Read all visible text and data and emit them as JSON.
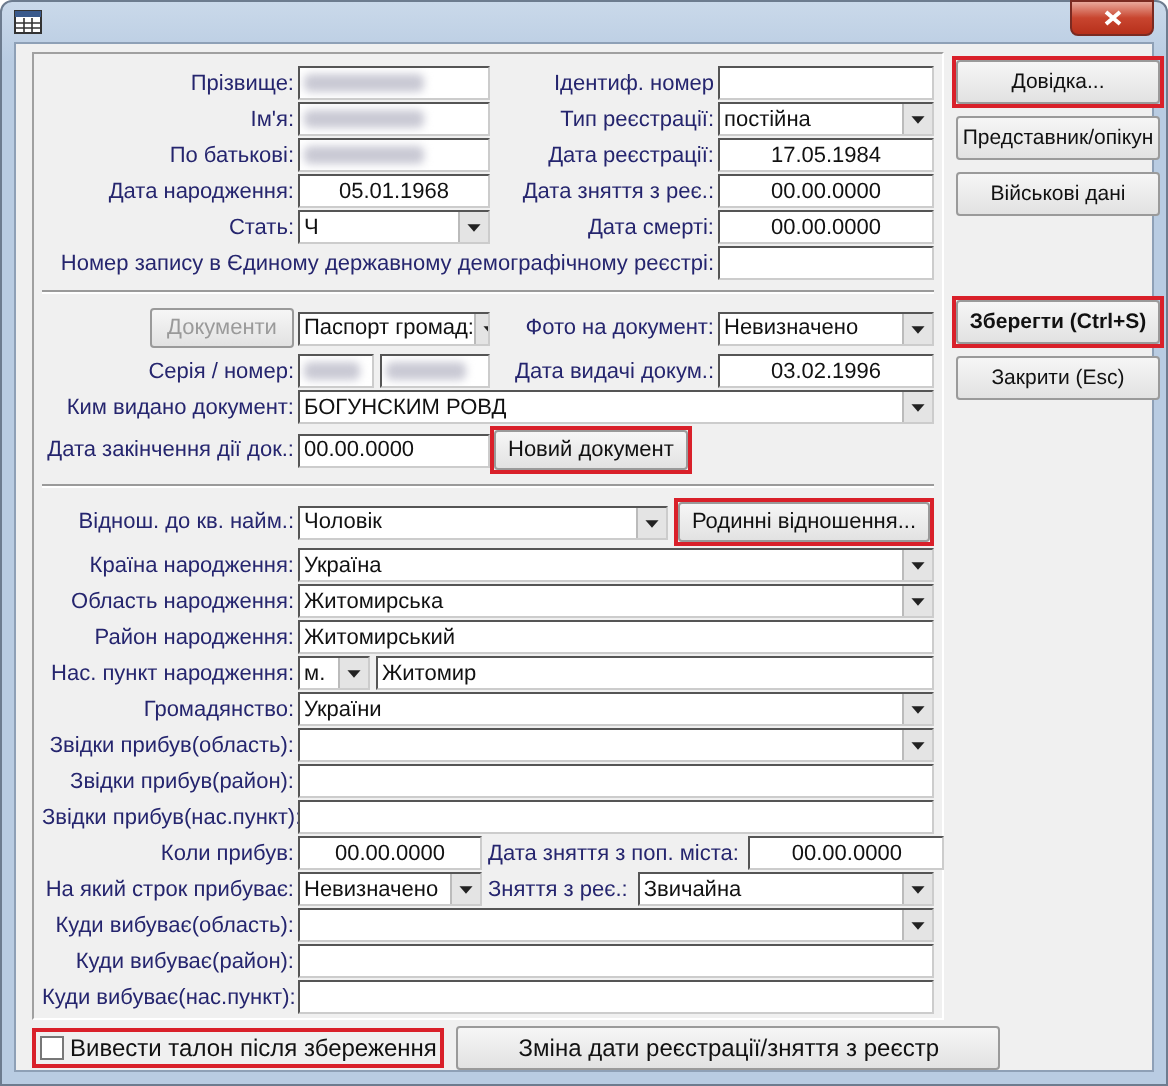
{
  "personal": [
    {
      "kind": "pair",
      "cells": [
        {
          "kind": "label",
          "text": "Прізвище:"
        },
        {
          "kind": "text",
          "redacted": true
        },
        {
          "kind": "label",
          "text": "Ідентиф. номер"
        },
        {
          "kind": "text"
        }
      ]
    },
    {
      "kind": "pair",
      "cells": [
        {
          "kind": "label",
          "text": "Ім'я:"
        },
        {
          "kind": "text",
          "redacted": true
        },
        {
          "kind": "label",
          "text": "Тип реєстрації:"
        },
        {
          "kind": "select",
          "value": "постійна"
        }
      ]
    },
    {
      "kind": "pair",
      "cells": [
        {
          "kind": "label",
          "text": "По батькові:"
        },
        {
          "kind": "text",
          "redacted": true
        },
        {
          "kind": "label",
          "text": "Дата реєстрації:"
        },
        {
          "kind": "date",
          "value": "17.05.1984"
        }
      ]
    },
    {
      "kind": "pair",
      "cells": [
        {
          "kind": "label",
          "text": "Дата народження:"
        },
        {
          "kind": "date",
          "value": "05.01.1968"
        },
        {
          "kind": "label",
          "text": "Дата зняття з реє.:"
        },
        {
          "kind": "date",
          "value": "00.00.0000"
        }
      ]
    },
    {
      "kind": "pair",
      "cells": [
        {
          "kind": "label",
          "text": "Стать:"
        },
        {
          "kind": "select",
          "value": "Ч"
        },
        {
          "kind": "label",
          "text": "Дата смерті:"
        },
        {
          "kind": "date",
          "value": "00.00.0000"
        }
      ]
    },
    {
      "kind": "long",
      "cells": [
        {
          "kind": "label",
          "text": "Номер запису в Єдиному державному демографічному реєстрі:"
        },
        {
          "kind": "text"
        }
      ]
    }
  ],
  "document": [
    {
      "kind": "pair",
      "cells": [
        {
          "kind": "button",
          "text": "Документи",
          "disabled": true,
          "highlighted": false
        },
        {
          "kind": "select",
          "value": "Паспорт громад:"
        },
        {
          "kind": "label",
          "text": "Фото на документ:"
        },
        {
          "kind": "select",
          "value": "Невизначено"
        }
      ]
    },
    {
      "kind": "pair",
      "cells": [
        {
          "kind": "label",
          "text": "Серія / номер:"
        },
        {
          "kind": "split",
          "redacted": true
        },
        {
          "kind": "label",
          "text": "Дата видачі докум.:"
        },
        {
          "kind": "date",
          "value": "03.02.1996"
        }
      ]
    },
    {
      "kind": "wide",
      "cells": [
        {
          "kind": "label",
          "text": "Ким видано документ:"
        },
        {
          "kind": "select",
          "value": "БОГУНСКИМ РОВД"
        }
      ]
    },
    {
      "kind": "field-button",
      "cells": [
        {
          "kind": "label",
          "text": "Дата закінчення дії док.:"
        },
        {
          "kind": "text",
          "value": "00.00.0000"
        },
        {
          "kind": "button",
          "text": "Новий документ",
          "disabled": false,
          "highlighted": true
        }
      ]
    }
  ],
  "residence": [
    {
      "kind": "select-button",
      "cells": [
        {
          "kind": "label",
          "text": "Віднош. до кв. найм.:"
        },
        {
          "kind": "select",
          "value": "Чоловік"
        },
        {
          "kind": "button",
          "text": "Родинні відношення...",
          "disabled": false,
          "highlighted": true
        }
      ]
    },
    {
      "kind": "wide",
      "cells": [
        {
          "kind": "label",
          "text": "Країна народження:"
        },
        {
          "kind": "select",
          "value": "Україна"
        }
      ]
    },
    {
      "kind": "wide",
      "cells": [
        {
          "kind": "label",
          "text": "Область народження:"
        },
        {
          "kind": "select",
          "value": "Житомирська"
        }
      ]
    },
    {
      "kind": "wide",
      "cells": [
        {
          "kind": "label",
          "text": "Район народження:"
        },
        {
          "kind": "text",
          "value": "Житомирський"
        }
      ]
    },
    {
      "kind": "prefix",
      "cells": [
        {
          "kind": "label",
          "text": "Нас. пункт народження:"
        },
        {
          "kind": "select",
          "value": "м."
        },
        {
          "kind": "text",
          "value": "Житомир"
        }
      ]
    },
    {
      "kind": "wide",
      "cells": [
        {
          "kind": "label",
          "text": "Громадянство:"
        },
        {
          "kind": "select",
          "value": "України"
        }
      ]
    },
    {
      "kind": "wide",
      "cells": [
        {
          "kind": "label",
          "text": "Звідки прибув(область):"
        },
        {
          "kind": "select"
        }
      ]
    },
    {
      "kind": "wide",
      "cells": [
        {
          "kind": "label",
          "text": "Звідки прибув(район):"
        },
        {
          "kind": "text"
        }
      ]
    },
    {
      "kind": "wide",
      "cells": [
        {
          "kind": "label",
          "text": "Звідки прибув(нас.пункт):"
        },
        {
          "kind": "text"
        }
      ]
    },
    {
      "kind": "double",
      "cells": [
        {
          "kind": "label",
          "text": "Коли прибув:"
        },
        {
          "kind": "date",
          "value": "00.00.0000"
        },
        {
          "kind": "label",
          "text": "Дата зняття з поп. міста:"
        },
        {
          "kind": "date",
          "value": "00.00.0000"
        }
      ]
    },
    {
      "kind": "double",
      "cells": [
        {
          "kind": "label",
          "text": "На який строк прибуває:"
        },
        {
          "kind": "select",
          "value": "Невизначено"
        },
        {
          "kind": "label",
          "text": "Зняття з реє.:"
        },
        {
          "kind": "select",
          "value": "Звичайна"
        }
      ]
    },
    {
      "kind": "wide",
      "cells": [
        {
          "kind": "label",
          "text": "Куди вибуває(область):"
        },
        {
          "kind": "select"
        }
      ]
    },
    {
      "kind": "wide",
      "cells": [
        {
          "kind": "label",
          "text": "Куди вибуває(район):"
        },
        {
          "kind": "text"
        }
      ]
    },
    {
      "kind": "wide",
      "cells": [
        {
          "kind": "label",
          "text": "Куди вибуває(нас.пункт):"
        },
        {
          "kind": "text"
        }
      ]
    }
  ],
  "side_buttons": [
    [
      {
        "text": "Довідка...",
        "bold": false,
        "highlighted": true
      },
      {
        "text": "Представник/опікун",
        "bold": false,
        "highlighted": false
      },
      {
        "text": "Військові дані",
        "bold": false,
        "highlighted": false
      }
    ],
    [
      {
        "text": "Зберегти (Ctrl+S)",
        "bold": true,
        "highlighted": true
      },
      {
        "text": "Закрити (Esc)",
        "bold": false,
        "highlighted": false
      }
    ]
  ],
  "print_option": {
    "label": "Вивести талон після збереження",
    "checked": false,
    "highlighted": true
  },
  "bottom_button": {
    "text": "Зміна дати реєстрації/зняття з реєстр"
  }
}
